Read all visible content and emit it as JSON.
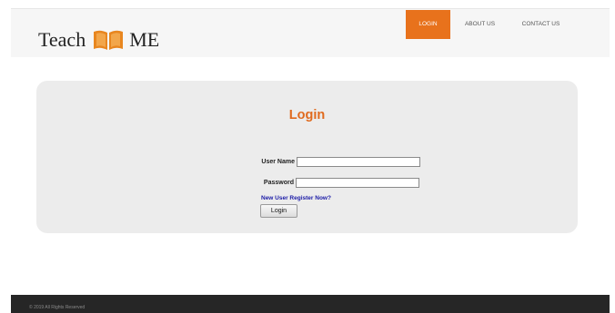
{
  "brand": {
    "name_left": "Teach",
    "name_right": "ME",
    "icon": "open-book-icon",
    "icon_color": "#e8861f"
  },
  "nav": {
    "items": [
      {
        "label": "LOGIN",
        "active": true
      },
      {
        "label": "ABOUT US",
        "active": false
      },
      {
        "label": "CONTACT US",
        "active": false
      }
    ],
    "active_color": "#e8721c"
  },
  "login_form": {
    "title": "Login",
    "title_color": "#e06a1e",
    "username_label": "User Name",
    "username_value": "",
    "password_label": "Password",
    "password_value": "",
    "register_link": "New User Register Now?",
    "submit_label": "Login"
  },
  "footer": {
    "text": "© 2019 All Rights Reserved"
  }
}
